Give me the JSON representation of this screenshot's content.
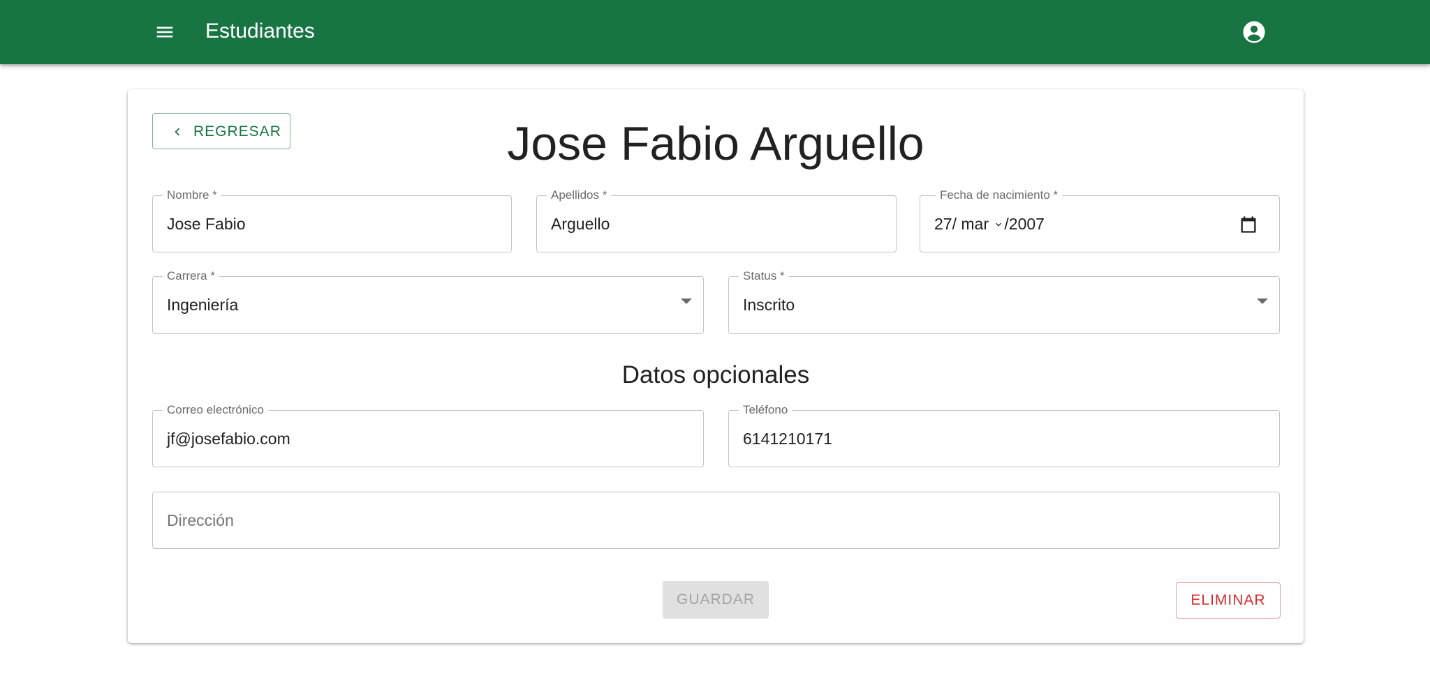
{
  "appbar": {
    "title": "Estudiantes",
    "menu_icon": "menu-icon",
    "account_icon": "account-circle-icon",
    "color": "#187443"
  },
  "card": {
    "back_label": "REGRESAR",
    "title": "Jose Fabio Arguello"
  },
  "form": {
    "nombre": {
      "label": "Nombre *",
      "value": "Jose Fabio"
    },
    "apellidos": {
      "label": "Apellidos *",
      "value": "Arguello"
    },
    "fecha": {
      "label": "Fecha de nacimiento *",
      "day": "27",
      "month": "mar",
      "year": "2007",
      "sep": "/"
    },
    "carrera": {
      "label": "Carrera *",
      "value": "Ingeniería"
    },
    "status": {
      "label": "Status *",
      "value": "Inscrito"
    },
    "optional_title": "Datos opcionales",
    "correo": {
      "label": "Correo electrónico",
      "value": "jf@josefabio.com"
    },
    "telefono": {
      "label": "Teléfono",
      "value": "6141210171"
    },
    "direccion": {
      "placeholder": "Dirección"
    }
  },
  "actions": {
    "save_label": "GUARDAR",
    "delete_label": "ELIMINAR",
    "delete_color": "#d32f2f"
  }
}
